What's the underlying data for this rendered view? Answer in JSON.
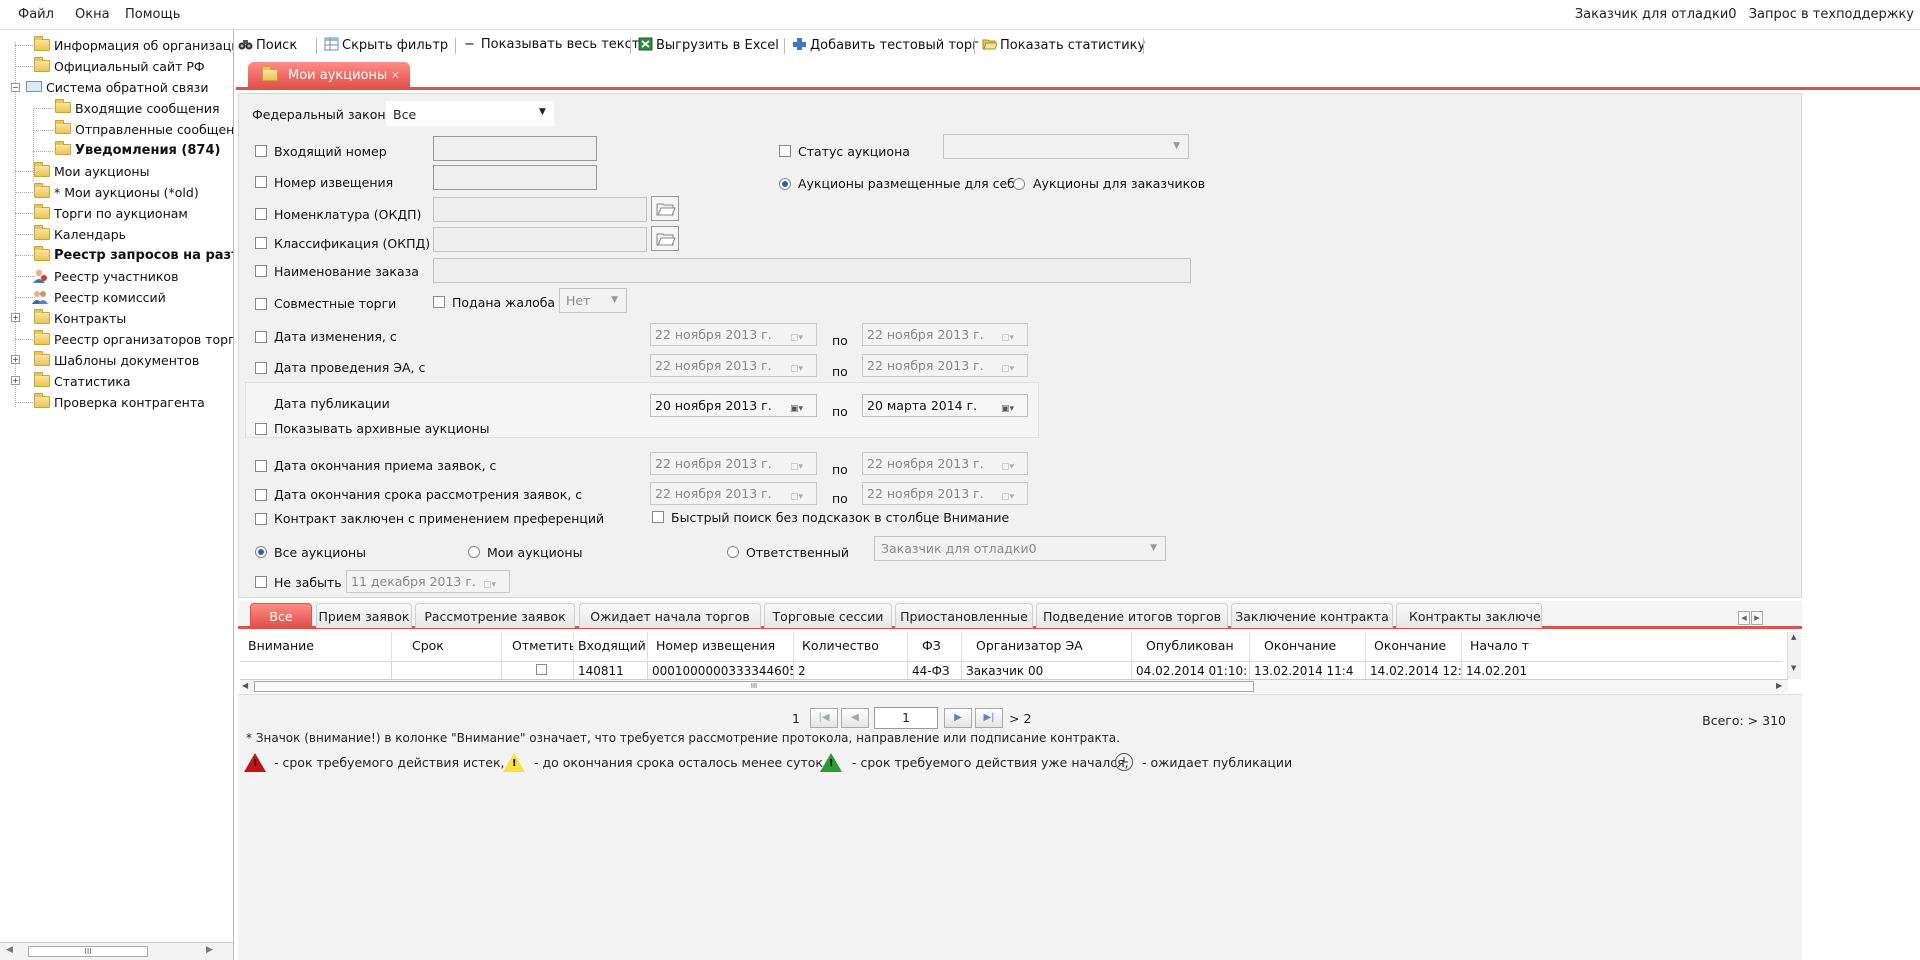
{
  "menu": {
    "file": "Файл",
    "windows": "Окна",
    "help": "Помощь"
  },
  "header": {
    "user": "Заказчик для отладки0",
    "support": "Запрос в техподдержку"
  },
  "tree": [
    {
      "label": "Информация об организации"
    },
    {
      "label": "Официальный сайт РФ"
    },
    {
      "label": "Система обратной связи"
    },
    {
      "label": "Входящие сообщения"
    },
    {
      "label": "Отправленные сообщения"
    },
    {
      "label": "Уведомления (874)"
    },
    {
      "label": "Мои аукционы"
    },
    {
      "label": "* Мои аукционы (*old)"
    },
    {
      "label": "Торги по аукционам"
    },
    {
      "label": "Календарь"
    },
    {
      "label": "Реестр запросов на разъя"
    },
    {
      "label": "Реестр участников"
    },
    {
      "label": "Реестр комиссий"
    },
    {
      "label": "Контракты"
    },
    {
      "label": "Реестр организаторов торгов"
    },
    {
      "label": "Шаблоны документов"
    },
    {
      "label": "Статистика"
    },
    {
      "label": "Проверка контрагента"
    }
  ],
  "toolbar": {
    "search": "Поиск",
    "hide_filter": "Скрыть фильтр",
    "show_full_text": "Показывать весь текст",
    "export_excel": "Выгрузить в Excel",
    "add_test": "Добавить тестовый торг",
    "show_stats": "Показать статистику"
  },
  "main_tab": "Мои аукционы",
  "filter": {
    "federal_law_label": "Федеральный закон:",
    "federal_law_value": "Все",
    "incoming_number": "Входящий номер",
    "notice_number": "Номер извещения",
    "nomenclature": "Номенклатура (ОКДП)",
    "classification": "Классификация (ОКПД)",
    "order_name": "Наименование заказа",
    "joint_trades": "Совместные торги",
    "complaint": "Подана жалоба",
    "complaint_value": "Нет",
    "auction_status": "Статус аукциона",
    "radio_self": "Аукционы размещенные для себя",
    "radio_customers": "Аукционы для заказчиков",
    "change_date": "Дата изменения, с",
    "ea_date": "Дата проведения ЭА, с",
    "pub_date": "Дата публикации",
    "show_archive": "Показывать архивные аукционы",
    "end_apps": "Дата окончания приема заявок, с",
    "end_review": "Дата окончания срока рассмотрения заявок, с",
    "preferences": "Контракт заключен с применением преференций",
    "fast_search": "Быстрый поиск без подсказок в столбце Внимание",
    "all_auctions": "Все аукционы",
    "my_auctions": "Мои аукционы",
    "responsible": "Ответственный",
    "responsible_value": "Заказчик для отладки0",
    "dont_forget": "Не забыть",
    "dont_forget_date": "11 декабря  2013 г.",
    "po": "по",
    "date_default": "22  ноября  2013 г.",
    "pub_from": "20  ноября  2013 г.",
    "pub_to": "20  марта  2014 г."
  },
  "bottom_tabs": [
    "Все",
    "Прием заявок",
    "Рассмотрение заявок",
    "Ожидает начала торгов",
    "Торговые сессии",
    "Приостановленные",
    "Подведение итогов торгов",
    "Заключение контракта",
    "Контракты заключе"
  ],
  "grid": {
    "columns": [
      "Внимание",
      "Срок",
      "Отметить",
      "Входящий",
      "Номер извещения",
      "Количество",
      "ФЗ",
      "Организатор ЭА",
      "Опубликован",
      "Окончание",
      "Окончание",
      "Начало т"
    ],
    "row": [
      "",
      "",
      "",
      "140811",
      "0001000000333344605",
      "2",
      "44-ФЗ",
      "Заказчик 00",
      "04.02.2014 01:10:",
      "13.02.2014 11:4",
      "14.02.2014 12:",
      "14.02.201"
    ]
  },
  "pager": {
    "first_page": "1",
    "current": "1",
    "more": "> 2",
    "total": "Всего: > 310"
  },
  "legend": {
    "note": "* Значок (внимание!) в колонке \"Внимание\" означает, что требуется рассмотрение протокола, направление или подписание контракта.",
    "expired": "- срок требуемого действия истек,",
    "less_day": "- до окончания срока осталось менее суток,",
    "started": "- срок требуемого действия уже начался,",
    "awaiting": "- ожидает публикации"
  },
  "colors": {
    "accent": "#e24d47",
    "red": "#c0141a",
    "yellow": "#f3e33a",
    "green": "#2c9a3a"
  }
}
